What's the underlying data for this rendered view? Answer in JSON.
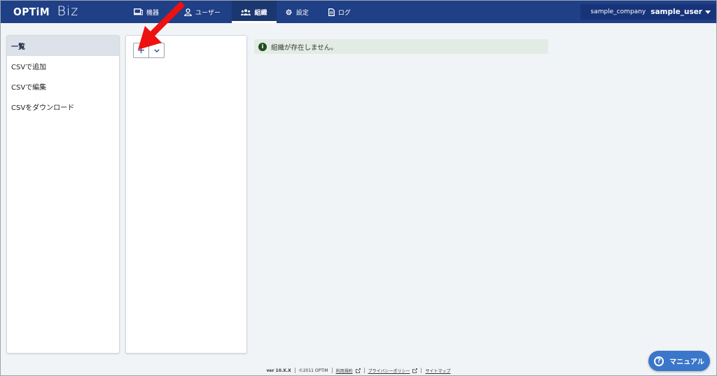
{
  "header": {
    "logo_brand": "OPTiM",
    "logo_product": "Biz",
    "nav": [
      {
        "label": "機器",
        "icon": "device-icon"
      },
      {
        "label": "ユーザー",
        "icon": "user-icon"
      },
      {
        "label": "組織",
        "icon": "organization-icon",
        "active": true
      },
      {
        "label": "設定",
        "icon": "gear-icon"
      },
      {
        "label": "ログ",
        "icon": "document-icon"
      }
    ],
    "company": "sample_company",
    "user": "sample_user"
  },
  "sidebar": {
    "items": [
      {
        "label": "一覧",
        "active": true
      },
      {
        "label": "CSVで追加"
      },
      {
        "label": "CSVで編集"
      },
      {
        "label": "CSVをダウンロード"
      }
    ]
  },
  "toolbar": {
    "add_label": "+"
  },
  "message": {
    "text": "組織が存在しません。",
    "icon": "info-icon",
    "icon_glyph": "i"
  },
  "footer": {
    "version": "ver 10.X.X",
    "copyright": "©2011 OPTiM",
    "terms": "利用規約",
    "privacy": "プライバシーポリシー",
    "sitemap": "サイトマップ"
  },
  "manual_button": {
    "label": "マニュアル",
    "icon_glyph": "?"
  },
  "colors": {
    "header": "#1f3f86",
    "accent": "#3a76c9",
    "info_bg": "#e3ece4",
    "annotation_arrow": "#ee1111"
  }
}
